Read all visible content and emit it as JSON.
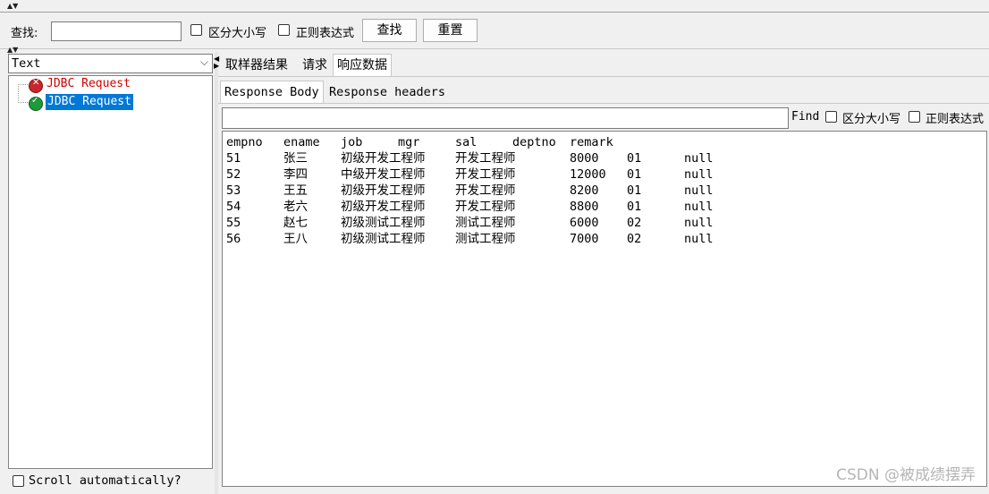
{
  "search_bar": {
    "label": "查找:",
    "value": "",
    "case_sensitive_label": "区分大小写",
    "regex_label": "正则表达式",
    "find_button": "查找",
    "reset_button": "重置"
  },
  "left_panel": {
    "renderer_select": "Text",
    "tree_items": [
      {
        "label": "JDBC Request",
        "status": "error",
        "selected": false
      },
      {
        "label": "JDBC Request",
        "status": "success",
        "selected": true
      }
    ],
    "scroll_auto_label": "Scroll automatically?"
  },
  "result_tabs": [
    "取样器结果",
    "请求",
    "响应数据"
  ],
  "response_tabs": [
    "Response Body",
    "Response headers"
  ],
  "find_row": {
    "value": "",
    "find_label": "Find",
    "case_sensitive_label": "区分大小写",
    "regex_label": "正则表达式"
  },
  "response_table": {
    "headers": [
      "empno",
      "ename",
      "job",
      "mgr",
      "sal",
      "deptno",
      "remark"
    ],
    "rows": [
      [
        "51",
        "张三",
        "初级开发工程师",
        "开发工程师",
        "8000",
        "01",
        "null"
      ],
      [
        "52",
        "李四",
        "中级开发工程师",
        "开发工程师",
        "12000",
        "01",
        "null"
      ],
      [
        "53",
        "王五",
        "初级开发工程师",
        "开发工程师",
        "8200",
        "01",
        "null"
      ],
      [
        "54",
        "老六",
        "初级开发工程师",
        "开发工程师",
        "8800",
        "01",
        "null"
      ],
      [
        "55",
        "赵七",
        "初级测试工程师",
        "测试工程师",
        "6000",
        "02",
        "null"
      ],
      [
        "56",
        "王八",
        "初级测试工程师",
        "测试工程师",
        "7000",
        "02",
        "null"
      ]
    ]
  },
  "watermark": "CSDN @被成绩摆弄",
  "colors": {
    "error_text": "#d40000",
    "selection_bg": "#0078d7",
    "success_icon": "#1f9a3a",
    "error_icon": "#c8262d"
  }
}
